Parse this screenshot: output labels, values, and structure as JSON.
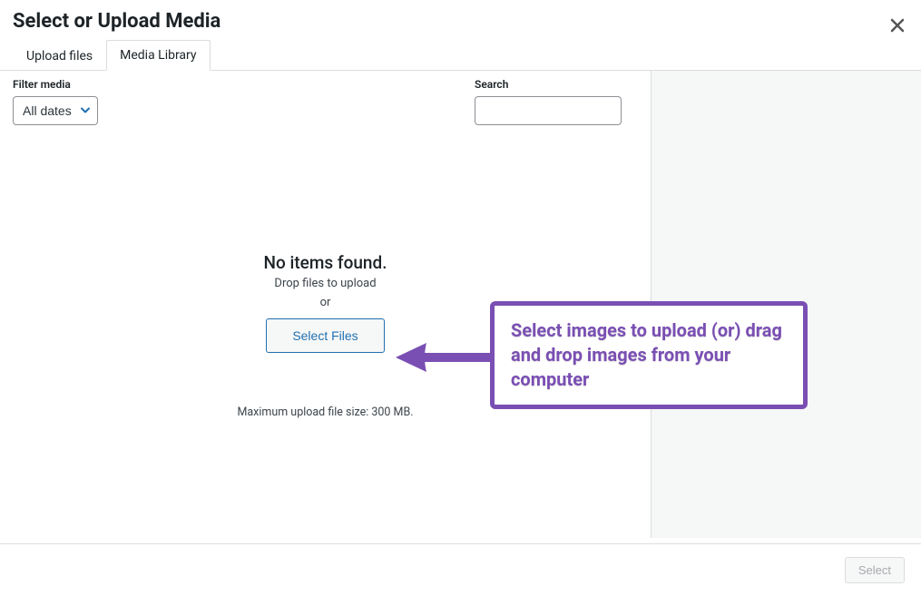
{
  "header": {
    "title": "Select or Upload Media"
  },
  "tabs": {
    "upload": "Upload files",
    "library": "Media Library"
  },
  "filters": {
    "label": "Filter media",
    "dates_value": "All dates"
  },
  "search": {
    "label": "Search"
  },
  "empty": {
    "title": "No items found.",
    "drop": "Drop files to upload",
    "or": "or",
    "button": "Select Files",
    "max": "Maximum upload file size: 300 MB."
  },
  "callout": {
    "text": "Select images to upload (or) drag and drop images from your computer"
  },
  "footer": {
    "select": "Select"
  }
}
